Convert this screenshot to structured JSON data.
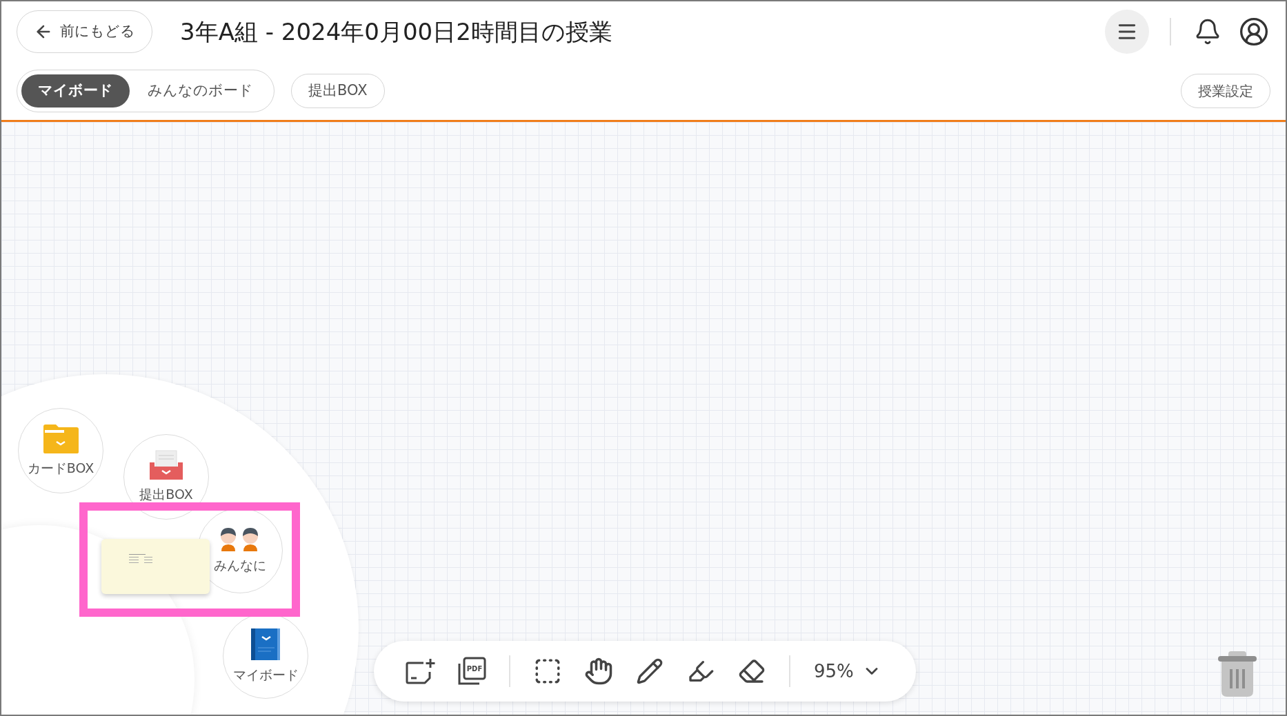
{
  "header": {
    "back_button": "前にもどる",
    "title": "3年A組 - 2024年0月00日2時間目の授業"
  },
  "board_tabs": [
    {
      "label": "マイボード",
      "selected": true
    },
    {
      "label": "みんなのボード",
      "selected": false
    }
  ],
  "submit_button": "提出BOX",
  "settings_button": "授業設定",
  "radial_menu": [
    {
      "kind": "folder",
      "label": "カードBOX"
    },
    {
      "kind": "tray",
      "label": "提出BOX"
    },
    {
      "kind": "people",
      "label": "みんなに"
    },
    {
      "kind": "notebook",
      "label": "マイボード"
    }
  ],
  "toolbar": {
    "tools": [
      {
        "kind": "add-card"
      },
      {
        "kind": "pdf",
        "label": "PDF"
      },
      {
        "kind": "divider"
      },
      {
        "kind": "select"
      },
      {
        "kind": "hand"
      },
      {
        "kind": "pen"
      },
      {
        "kind": "marker"
      },
      {
        "kind": "eraser"
      },
      {
        "kind": "divider"
      }
    ],
    "zoom": "95%"
  }
}
